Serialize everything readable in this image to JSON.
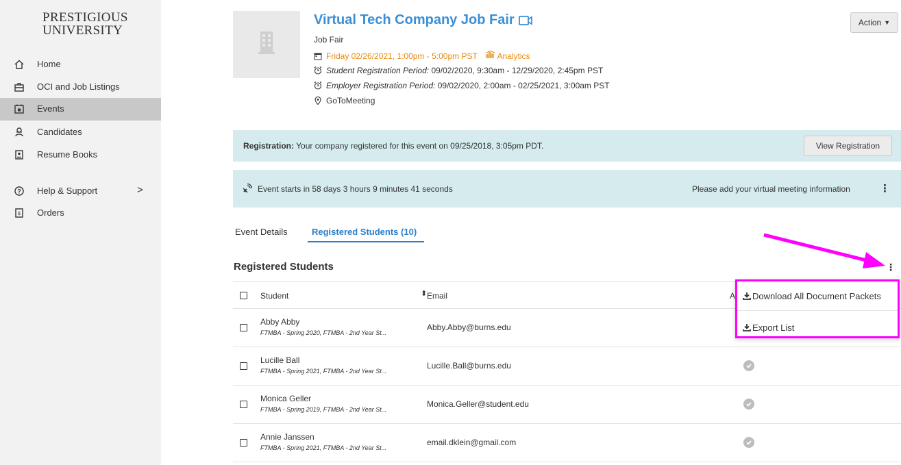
{
  "sidebar": {
    "logo_line1": "PRESTIGIOUS",
    "logo_line2": "UNIVERSITY",
    "items": [
      {
        "label": "Home",
        "icon": "home-icon"
      },
      {
        "label": "OCI and Job Listings",
        "icon": "briefcase-icon"
      },
      {
        "label": "Events",
        "icon": "calendar-icon",
        "active": true
      },
      {
        "label": "Candidates",
        "icon": "candidates-icon"
      },
      {
        "label": "Resume Books",
        "icon": "resume-book-icon"
      },
      {
        "label": "Help & Support",
        "icon": "help-icon",
        "chevron": ">"
      },
      {
        "label": "Orders",
        "icon": "receipt-icon"
      }
    ]
  },
  "event": {
    "title": "Virtual Tech Company Job Fair",
    "type": "Job Fair",
    "date": "Friday 02/26/2021, 1:00pm - 5:00pm PST",
    "analytics": "Analytics",
    "student_reg_label": "Student Registration Period:",
    "student_reg_value": "09/02/2020, 9:30am - 12/29/2020, 2:45pm PST",
    "employer_reg_label": "Employer Registration Period:",
    "employer_reg_value": "09/02/2020, 2:00am - 02/25/2021, 3:00am PST",
    "location": "GoToMeeting",
    "action_label": "Action"
  },
  "registration_banner": {
    "label": "Registration:",
    "text": "Your company registered for this event on 09/25/2018, 3:05pm PDT.",
    "button": "View Registration"
  },
  "countdown_banner": {
    "text": "Event starts in 58 days 3 hours 9 minutes 41 seconds",
    "right_text": "Please add your virtual meeting information"
  },
  "tabs": {
    "details": "Event Details",
    "registered": "Registered Students (10)"
  },
  "section": {
    "title": "Registered Students"
  },
  "table": {
    "columns": {
      "student": "Student",
      "email": "Email",
      "third": "A"
    },
    "rows": [
      {
        "name": "Abby Abby",
        "program": "FTMBA - Spring 2020, FTMBA - 2nd Year St...",
        "email": "Abby.Abby@burns.edu"
      },
      {
        "name": "Lucille Ball",
        "program": "FTMBA - Spring 2021, FTMBA - 2nd Year St...",
        "email": "Lucille.Ball@burns.edu"
      },
      {
        "name": "Monica Geller",
        "program": "FTMBA - Spring 2019, FTMBA - 2nd Year St...",
        "email": "Monica.Geller@student.edu"
      },
      {
        "name": "Annie Janssen",
        "program": "FTMBA - Spring 2021, FTMBA - 2nd Year St...",
        "email": "email.dklein@gmail.com"
      }
    ]
  },
  "menu": {
    "download_all": "Download All Document Packets",
    "export_list": "Export List"
  },
  "colors": {
    "title_blue": "#3b8fd6",
    "orange": "#e8890c",
    "banner": "#d5ebee",
    "highlight": "#ff00ff"
  }
}
